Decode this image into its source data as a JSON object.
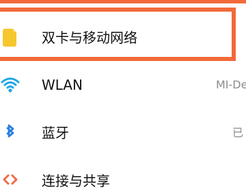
{
  "screen": {
    "accent_color": "#f26a3a"
  },
  "settings": {
    "items": [
      {
        "label": "双卡与移动网络",
        "icon": "sim-card-icon",
        "icon_color": "#f6c62d",
        "value": ""
      },
      {
        "label": "WLAN",
        "icon": "wifi-icon",
        "icon_color": "#1fa6e8",
        "value": "MI-De"
      },
      {
        "label": "蓝牙",
        "icon": "bluetooth-icon",
        "icon_color": "#2a7fe0",
        "value": "已"
      },
      {
        "label": "连接与共享",
        "icon": "connection-sharing-icon",
        "icon_color": "#ef6b4a",
        "value": ""
      }
    ]
  }
}
